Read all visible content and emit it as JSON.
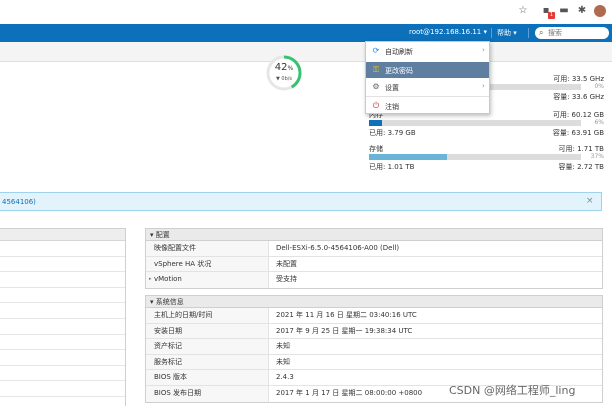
{
  "browser": {
    "icons": [
      "star-icon",
      "extension-icon",
      "media-icon",
      "puzzle-icon",
      "profile-avatar",
      "more-icon"
    ],
    "extension_badge": "1"
  },
  "header": {
    "user": "root@192.168.16.11 ▾",
    "help": "帮助 ▾",
    "search_placeholder": "搜索",
    "bg_color": "#0c70ba"
  },
  "gauge": {
    "value_text": "42",
    "unit": "%",
    "sub_text": "▼ 0b/s",
    "percent": 42,
    "color": "#38c172"
  },
  "resources": {
    "cpu": {
      "free": "可用: 33.5 GHz",
      "pct": "0%",
      "capacity": "容量: 33.6 GHz",
      "fill": 0.0
    },
    "memory": {
      "label": "内存",
      "free": "可用: 60.12 GB",
      "pct": "6%",
      "used": "已用: 3.79 GB",
      "capacity": "容量: 63.91 GB",
      "fill": 0.06
    },
    "storage": {
      "label": "存储",
      "free": "可用: 1.71 TB",
      "pct": "37%",
      "used": "已用: 1.01 TB",
      "capacity": "容量: 2.72 TB",
      "fill": 0.37
    }
  },
  "alert": {
    "text": "4564106)",
    "close": "×"
  },
  "config_panel": {
    "title": "▾ 配置",
    "rows": [
      {
        "key": "映像配置文件",
        "value": "Dell-ESXi-6.5.0-4564106-A00 (Dell)"
      },
      {
        "key": "vSphere HA 状况",
        "value": "未配置"
      },
      {
        "key": "vMotion",
        "value": "受支持",
        "expander": "▸"
      }
    ]
  },
  "sysinfo_panel": {
    "title": "▾ 系统信息",
    "rows": [
      {
        "key": "主机上的日期/时间",
        "value": "2021 年 11 月 16 日 星期二 03:40:16 UTC"
      },
      {
        "key": "安装日期",
        "value": "2017 年 9 月 25 日 星期一 19:38:34 UTC"
      },
      {
        "key": "资产标记",
        "value": "未知"
      },
      {
        "key": "服务标记",
        "value": "未知"
      },
      {
        "key": "BIOS 版本",
        "value": "2.4.3"
      },
      {
        "key": "BIOS 发布日期",
        "value": "2017 年 1 月 17 日 星期二 08:00:00 +0800"
      }
    ]
  },
  "menu": {
    "items": [
      {
        "label": "自动刷新",
        "icon": "refresh-icon",
        "arrow": "›"
      },
      {
        "label": "更改密码",
        "icon": "key-icon",
        "active": true
      },
      {
        "label": "设置",
        "icon": "gear-icon",
        "arrow": "›"
      },
      {
        "label": "注销",
        "icon": "logout-icon"
      }
    ]
  },
  "watermark": "CSDN @网络工程师_ling"
}
